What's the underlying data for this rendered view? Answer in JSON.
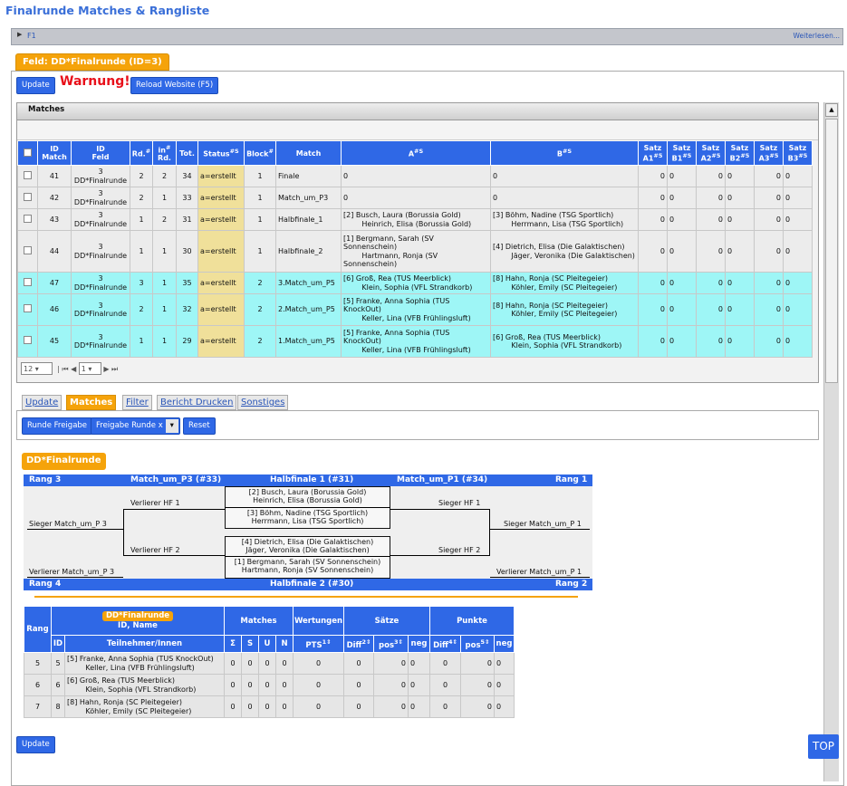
{
  "page": {
    "title": "Finalrunde Matches & Rangliste"
  },
  "f1bar": {
    "label": "F1",
    "more": "Weiterlesen..."
  },
  "feld": {
    "tab_label": "Feld: DD*Finalrunde (ID=3)"
  },
  "toolbar": {
    "update_label": "Update",
    "warning": "Warnung!",
    "reload_label": "Reload Website (F5)"
  },
  "matches": {
    "header": "Matches",
    "columns": [
      "",
      "ID\nMatch",
      "ID\nFeld",
      "Rd.",
      "in\nRd.",
      "Tot.",
      "Status",
      "Block",
      "Match",
      "A",
      "B",
      "Satz\nA1",
      "Satz\nB1",
      "Satz\nA2",
      "Satz\nB2",
      "Satz\nA3",
      "Satz\nB3"
    ],
    "col_sort": {
      "Status": "#S",
      "A": "#S",
      "B": "#S",
      "Satz A1": "#5",
      "Satz B1": "#5",
      "Satz A2": "#5",
      "Satz B2": "#5",
      "Satz A3": "#5",
      "Satz B3": "#5"
    },
    "rows": [
      {
        "id": "41",
        "feld": "3\nDD*Finalrunde",
        "rd": "2",
        "inrd": "2",
        "tot": "34",
        "status": "a=erstellt",
        "block": "1",
        "match": "Finale",
        "a": "0",
        "b": "0",
        "s": [
          "0",
          "0",
          "0",
          "0",
          "0",
          "0"
        ],
        "color": "white"
      },
      {
        "id": "42",
        "feld": "3\nDD*Finalrunde",
        "rd": "2",
        "inrd": "1",
        "tot": "33",
        "status": "a=erstellt",
        "block": "1",
        "match": "Match_um_P3",
        "a": "0",
        "b": "0",
        "s": [
          "0",
          "0",
          "0",
          "0",
          "0",
          "0"
        ],
        "color": "white"
      },
      {
        "id": "43",
        "feld": "3\nDD*Finalrunde",
        "rd": "1",
        "inrd": "2",
        "tot": "31",
        "status": "a=erstellt",
        "block": "1",
        "match": "Halbfinale_1",
        "a": "[2] Busch, Laura (Borussia Gold)\n        Heinrich, Elisa (Borussia Gold)",
        "b": "[3] Böhm, Nadine (TSG Sportlich)\n        Herrmann, Lisa (TSG Sportlich)",
        "s": [
          "0",
          "0",
          "0",
          "0",
          "0",
          "0"
        ],
        "color": "white"
      },
      {
        "id": "44",
        "feld": "3\nDD*Finalrunde",
        "rd": "1",
        "inrd": "1",
        "tot": "30",
        "status": "a=erstellt",
        "block": "1",
        "match": "Halbfinale_2",
        "a": "[1] Bergmann, Sarah (SV Sonnenschein)\n        Hartmann, Ronja (SV Sonnenschein)",
        "b": "[4] Dietrich, Elisa (Die Galaktischen)\n        Jäger, Veronika (Die Galaktischen)",
        "s": [
          "0",
          "0",
          "0",
          "0",
          "0",
          "0"
        ],
        "color": "white"
      },
      {
        "id": "47",
        "feld": "3\nDD*Finalrunde",
        "rd": "3",
        "inrd": "1",
        "tot": "35",
        "status": "a=erstellt",
        "block": "2",
        "match": "3.Match_um_P5",
        "a": "[6] Groß, Rea (TUS Meerblick)\n        Klein, Sophia (VFL Strandkorb)",
        "b": "[8] Hahn, Ronja (SC Pleitegeier)\n        Köhler, Emily (SC Pleitegeier)",
        "s": [
          "0",
          "0",
          "0",
          "0",
          "0",
          "0"
        ],
        "color": "cyan"
      },
      {
        "id": "46",
        "feld": "3\nDD*Finalrunde",
        "rd": "2",
        "inrd": "1",
        "tot": "32",
        "status": "a=erstellt",
        "block": "2",
        "match": "2.Match_um_P5",
        "a": "[5] Franke, Anna Sophia (TUS KnockOut)\n        Keller, Lina (VFB Frühlingsluft)",
        "b": "[8] Hahn, Ronja (SC Pleitegeier)\n        Köhler, Emily (SC Pleitegeier)",
        "s": [
          "0",
          "0",
          "0",
          "0",
          "0",
          "0"
        ],
        "color": "cyan"
      },
      {
        "id": "45",
        "feld": "3\nDD*Finalrunde",
        "rd": "1",
        "inrd": "1",
        "tot": "29",
        "status": "a=erstellt",
        "block": "2",
        "match": "1.Match_um_P5",
        "a": "[5] Franke, Anna Sophia (TUS KnockOut)\n        Keller, Lina (VFB Frühlingsluft)",
        "b": "[6] Groß, Rea (TUS Meerblick)\n        Klein, Sophia (VFL Strandkorb)",
        "s": [
          "0",
          "0",
          "0",
          "0",
          "0",
          "0"
        ],
        "color": "cyan"
      }
    ],
    "pager": {
      "page_size": "12",
      "page": "1"
    }
  },
  "tabs": [
    "Update",
    "Matches",
    "Filter",
    "Bericht Drucken",
    "Sonstiges"
  ],
  "active_tab": "Matches",
  "panel": {
    "runde_freigabe": "Runde Freigabe",
    "freigabe_runde_x": "Freigabe Runde x",
    "reset": "Reset"
  },
  "bracket": {
    "badge": "DD*Finalrunde",
    "top": {
      "rang3": "Rang 3",
      "p3": "Match_um_P3 (#33)",
      "hf1": "Halbfinale 1 (#31)",
      "p1": "Match_um_P1 (#34)",
      "rang1": "Rang 1"
    },
    "bottom": {
      "rang4": "Rang 4",
      "hf2": "Halbfinale 2 (#30)",
      "rang2": "Rang 2"
    },
    "labels": {
      "verlierer_hf1": "Verlierer HF 1",
      "sieger_hf1": "Sieger HF 1",
      "sieger_p3": "Sieger Match_um_P 3",
      "sieger_p1": "Sieger Match_um_P 1",
      "verlierer_hf2": "Verlierer HF 2",
      "sieger_hf2": "Sieger HF 2",
      "verlierer_p3": "Verlierer Match_um_P 3",
      "verlierer_p1": "Verlierer Match_um_P 1"
    },
    "hf1_a": "[2] Busch, Laura (Borussia Gold)\nHeinrich, Elisa (Borussia Gold)",
    "hf1_b": "[3] Böhm, Nadine (TSG Sportlich)\nHerrmann, Lisa (TSG Sportlich)",
    "hf2_a": "[4] Dietrich, Elisa (Die Galaktischen)\nJäger, Veronika (Die Galaktischen)",
    "hf2_b": "[1] Bergmann, Sarah (SV Sonnenschein)\nHartmann, Ronja (SV Sonnenschein)"
  },
  "ranking": {
    "badge": "DD*Finalrunde",
    "headers": {
      "rang": "Rang",
      "id_name": "ID, Name",
      "matches": "Matches",
      "wertungen": "Wertungen",
      "saetze": "Sätze",
      "punkte": "Punkte",
      "id": "ID",
      "teilnehmer": "Teilnehmer/Innen",
      "sigma": "Σ",
      "s": "S",
      "u": "U",
      "n": "N",
      "pts": "PTS",
      "diff": "Diff",
      "pos": "pos",
      "neg": "neg"
    },
    "rows": [
      {
        "rang": "5",
        "id": "5",
        "name": "[5] Franke, Anna Sophia (TUS KnockOut)\n        Keller, Lina (VFB Frühlingsluft)",
        "vals": [
          "0",
          "0",
          "0",
          "0",
          "0",
          "0",
          "0",
          "0",
          "0",
          "0",
          "0"
        ]
      },
      {
        "rang": "6",
        "id": "6",
        "name": "[6] Groß, Rea (TUS Meerblick)\n        Klein, Sophia (VFL Strandkorb)",
        "vals": [
          "0",
          "0",
          "0",
          "0",
          "0",
          "0",
          "0",
          "0",
          "0",
          "0",
          "0"
        ]
      },
      {
        "rang": "7",
        "id": "8",
        "name": "[8] Hahn, Ronja (SC Pleitegeier)\n        Köhler, Emily (SC Pleitegeier)",
        "vals": [
          "0",
          "0",
          "0",
          "0",
          "0",
          "0",
          "0",
          "0",
          "0",
          "0",
          "0"
        ]
      }
    ]
  },
  "footer": {
    "update_label": "Update",
    "top_label": "TOP"
  },
  "colors": {
    "accent": "#2f68e6",
    "orange": "#f5a30a",
    "warning": "#e8101a",
    "cyan_row": "#9ef6f6",
    "status_cell": "#f0e09a"
  }
}
